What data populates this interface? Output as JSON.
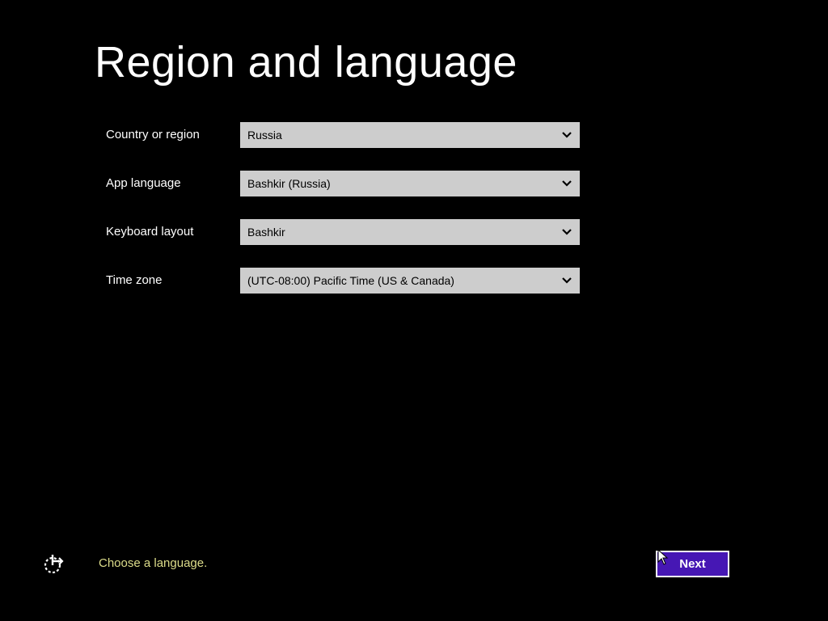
{
  "page": {
    "title": "Region and language"
  },
  "form": {
    "fields": [
      {
        "label": "Country or region",
        "value": "Russia",
        "icon": "chevron-down-icon"
      },
      {
        "label": "App language",
        "value": "Bashkir (Russia)",
        "icon": "chevron-down-icon"
      },
      {
        "label": "Keyboard layout",
        "value": "Bashkir",
        "icon": "chevron-down-icon"
      },
      {
        "label": "Time zone",
        "value": "(UTC-08:00) Pacific Time (US & Canada)",
        "icon": "chevron-down-icon"
      }
    ]
  },
  "footer": {
    "status_icon": "ease-of-access-icon",
    "status_text": "Choose a language.",
    "next_label": "Next"
  },
  "colors": {
    "background": "#000000",
    "dropdown_bg": "#cdcdcd",
    "accent": "#4617b4",
    "status_text": "#dcdc8a"
  }
}
